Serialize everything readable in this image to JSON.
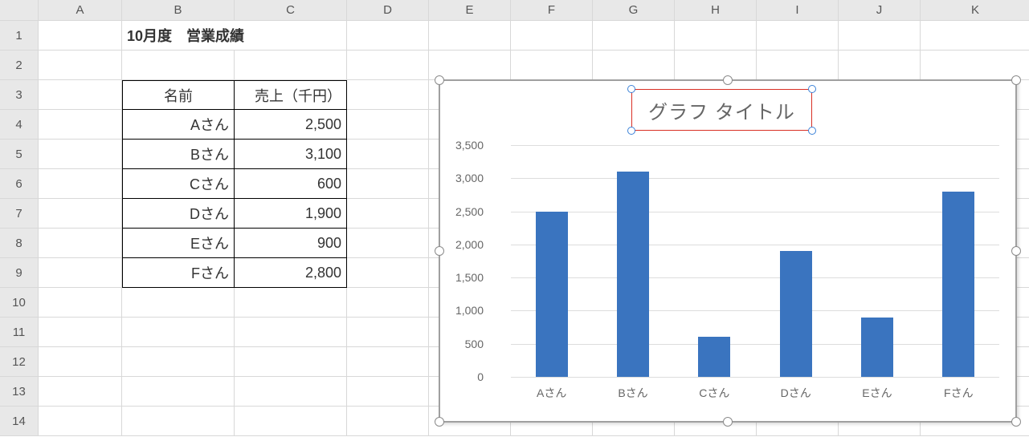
{
  "columns": [
    "A",
    "B",
    "C",
    "D",
    "E",
    "F",
    "G",
    "H",
    "I",
    "J",
    "K"
  ],
  "rows": [
    "1",
    "2",
    "3",
    "4",
    "5",
    "6",
    "7",
    "8",
    "9",
    "10",
    "11",
    "12",
    "13",
    "14"
  ],
  "title_cell": "10月度　営業成績",
  "table": {
    "header_name": "名前",
    "header_value": "売上（千円）",
    "rows": [
      {
        "name": "Aさん",
        "value_display": "2,500"
      },
      {
        "name": "Bさん",
        "value_display": "3,100"
      },
      {
        "name": "Cさん",
        "value_display": "600"
      },
      {
        "name": "Dさん",
        "value_display": "1,900"
      },
      {
        "name": "Eさん",
        "value_display": "900"
      },
      {
        "name": "Fさん",
        "value_display": "2,800"
      }
    ]
  },
  "chart_title": "グラフ タイトル",
  "y_ticks": [
    "0",
    "500",
    "1,000",
    "1,500",
    "2,000",
    "2,500",
    "3,000",
    "3,500"
  ],
  "chart_data": {
    "type": "bar",
    "title": "グラフ タイトル",
    "xlabel": "",
    "ylabel": "",
    "categories": [
      "Aさん",
      "Bさん",
      "Cさん",
      "Dさん",
      "Eさん",
      "Fさん"
    ],
    "values": [
      2500,
      3100,
      600,
      1900,
      900,
      2800
    ],
    "ylim": [
      0,
      3500
    ],
    "grid": true,
    "bar_color": "#3a74bf"
  }
}
